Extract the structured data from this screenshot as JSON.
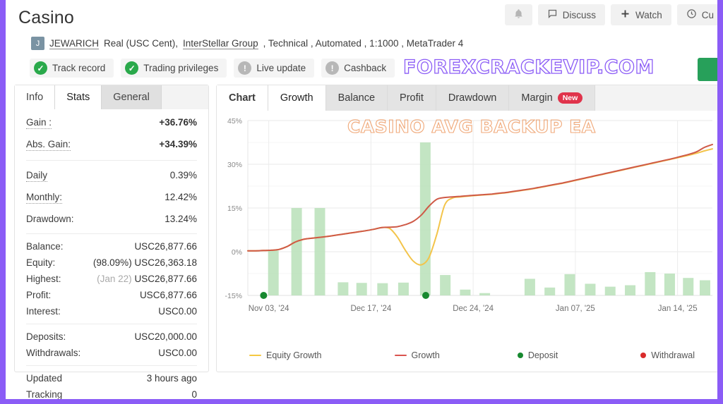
{
  "header": {
    "title": "Casino",
    "buttons": [
      {
        "name": "notifications",
        "icon": "bell-icon",
        "label": ""
      },
      {
        "name": "discuss",
        "icon": "comment-icon",
        "label": "Discuss"
      },
      {
        "name": "watch",
        "icon": "plus-icon",
        "label": "Watch"
      },
      {
        "name": "custom",
        "icon": "clock-icon",
        "label": "Cu"
      }
    ],
    "account": {
      "avatar_initial": "J",
      "name": "JEWARICH",
      "type": "Real (USC Cent),",
      "broker": "InterStellar Group",
      "meta": ", Technical , Automated , 1:1000 , MetaTrader 4"
    },
    "badges": [
      {
        "label": "Track record",
        "state": "ok"
      },
      {
        "label": "Trading privileges",
        "state": "ok"
      },
      {
        "label": "Live update",
        "state": "no"
      },
      {
        "label": "Cashback",
        "state": "no"
      }
    ],
    "watermark": "FOREXCRACKEVIP.COM"
  },
  "left_panel": {
    "tabs": [
      {
        "label": "Info",
        "active": false
      },
      {
        "label": "Stats",
        "active": true
      },
      {
        "label": "General",
        "active": false
      }
    ],
    "groups": [
      {
        "rows": [
          {
            "key": "Gain :",
            "value": "+36.76%",
            "style": "green",
            "dotted": true
          },
          {
            "key": "Abs. Gain:",
            "value": "+34.39%",
            "style": "green",
            "dotted": true
          }
        ]
      },
      {
        "rows": [
          {
            "key": "Daily",
            "value": "0.39%",
            "style": "",
            "dotted": true
          },
          {
            "key": "Monthly:",
            "value": "12.42%",
            "style": "",
            "dotted": true
          },
          {
            "key": "Drawdown:",
            "value": "13.24%",
            "style": "",
            "dotted": false
          }
        ]
      },
      {
        "rows": [
          {
            "key": "Balance:",
            "value": "USC26,877.66",
            "style": "",
            "dotted": false
          },
          {
            "key": "Equity:",
            "value": "(98.09%) USC26,363.18",
            "style": "",
            "dotted": false
          },
          {
            "key": "Highest:",
            "value": "(Jan 22) USC26,877.66",
            "style": "",
            "dotted": false,
            "prefix_muted": "(Jan 22)"
          },
          {
            "key": "Profit:",
            "value": "USC6,877.66",
            "style": "greenplain",
            "dotted": false
          },
          {
            "key": "Interest:",
            "value": "USC0.00",
            "style": "",
            "dotted": false
          }
        ]
      },
      {
        "rows": [
          {
            "key": "Deposits:",
            "value": "USC20,000.00",
            "style": "",
            "dotted": false
          },
          {
            "key": "Withdrawals:",
            "value": "USC0.00",
            "style": "",
            "dotted": false
          }
        ]
      },
      {
        "rows": [
          {
            "key": "Updated",
            "value": "3 hours ago",
            "style": "",
            "dotted": false
          },
          {
            "key": "Tracking",
            "value": "0",
            "style": "",
            "dotted": false
          }
        ]
      }
    ]
  },
  "chart_panel": {
    "tabs": [
      {
        "label": "Chart",
        "active": true,
        "badge": ""
      },
      {
        "label": "Growth",
        "active": true,
        "badge": ""
      },
      {
        "label": "Balance",
        "active": false,
        "badge": ""
      },
      {
        "label": "Profit",
        "active": false,
        "badge": ""
      },
      {
        "label": "Drawdown",
        "active": false,
        "badge": ""
      },
      {
        "label": "Margin",
        "active": false,
        "badge": "New"
      }
    ]
  },
  "chart_data": {
    "type": "line",
    "title": "CASINO AVG BACKUP EA",
    "xlabel": "",
    "ylabel": "",
    "ylim": [
      -15,
      45
    ],
    "yticks": [
      45,
      30,
      15,
      0,
      -15
    ],
    "ytick_labels": [
      "45%",
      "30%",
      "15%",
      "0%",
      "-15%"
    ],
    "xtick_labels": [
      "Nov 03, '24",
      "Dec 17, '24",
      "Dec 24, '24",
      "Jan 07, '25",
      "Jan 14, '25"
    ],
    "xtick_positions": [
      0.045,
      0.265,
      0.485,
      0.705,
      0.925
    ],
    "grid": true,
    "legend_position": "bottom",
    "legend": [
      {
        "name": "Equity Growth",
        "color": "#f5c842",
        "marker": "line"
      },
      {
        "name": "Growth",
        "color": "#d9534f",
        "marker": "line"
      },
      {
        "name": "Deposit",
        "color": "#17892f",
        "marker": "dot"
      },
      {
        "name": "Withdrawal",
        "color": "#d92b2b",
        "marker": "dot"
      }
    ],
    "series": [
      {
        "name": "Growth",
        "color": "#cf5a47",
        "values": [
          0.3,
          0.3,
          0.4,
          0.5,
          0.8,
          1.8,
          3.3,
          4.2,
          4.6,
          4.9,
          5.2,
          5.6,
          6.0,
          6.4,
          6.8,
          7.2,
          7.7,
          8.3,
          8.4,
          8.6,
          9.3,
          10.4,
          12.5,
          15.6,
          18.0,
          18.6,
          18.8,
          19.0,
          19.2,
          19.4,
          19.6,
          19.8,
          20.1,
          20.4,
          20.8,
          21.2,
          21.6,
          22.1,
          22.6,
          23.1,
          23.6,
          24.2,
          24.8,
          25.4,
          26.0,
          26.6,
          27.2,
          27.8,
          28.4,
          29.0,
          29.6,
          30.2,
          30.8,
          31.4,
          32.0,
          32.7,
          33.4,
          34.3,
          35.8,
          36.8
        ]
      },
      {
        "name": "Equity Growth",
        "color": "#f3c44a",
        "values": [
          0.3,
          0.3,
          0.4,
          0.5,
          0.8,
          1.8,
          3.3,
          4.2,
          4.6,
          4.9,
          5.2,
          5.6,
          6.0,
          6.4,
          6.8,
          7.2,
          7.7,
          8.3,
          8.0,
          5.0,
          0.5,
          -3.2,
          -4.5,
          -2.0,
          6.0,
          16.0,
          18.4,
          18.8,
          19.1,
          19.3,
          19.5,
          19.7,
          20.0,
          20.3,
          20.7,
          21.1,
          21.5,
          22.0,
          22.5,
          23.0,
          23.5,
          24.1,
          24.7,
          25.3,
          25.9,
          26.5,
          27.1,
          27.7,
          28.3,
          28.9,
          29.5,
          30.1,
          30.7,
          31.3,
          31.9,
          32.5,
          33.1,
          33.8,
          34.6,
          35.3
        ]
      }
    ],
    "bars": {
      "name": "Volume",
      "color": "#b8e0b8",
      "baseline": -15,
      "items": [
        {
          "x": 0.055,
          "value": 0.4
        },
        {
          "x": 0.105,
          "value": 15.0
        },
        {
          "x": 0.155,
          "value": 15.0
        },
        {
          "x": 0.205,
          "value": -10.5
        },
        {
          "x": 0.245,
          "value": -10.7
        },
        {
          "x": 0.29,
          "value": -10.8
        },
        {
          "x": 0.335,
          "value": -10.6
        },
        {
          "x": 0.382,
          "value": 37.5
        },
        {
          "x": 0.425,
          "value": -8.0
        },
        {
          "x": 0.468,
          "value": -13.0
        },
        {
          "x": 0.51,
          "value": -14.2
        },
        {
          "x": 0.607,
          "value": -9.3
        },
        {
          "x": 0.65,
          "value": -12.3
        },
        {
          "x": 0.693,
          "value": -7.7
        },
        {
          "x": 0.737,
          "value": -11.0
        },
        {
          "x": 0.78,
          "value": -12.0
        },
        {
          "x": 0.823,
          "value": -11.5
        },
        {
          "x": 0.866,
          "value": -7.0
        },
        {
          "x": 0.908,
          "value": -7.5
        },
        {
          "x": 0.948,
          "value": -9.0
        },
        {
          "x": 0.984,
          "value": -9.8
        }
      ]
    },
    "markers": [
      {
        "type": "Deposit",
        "x": 0.034,
        "y": -15,
        "color": "#17892f"
      },
      {
        "type": "Deposit",
        "x": 0.383,
        "y": -15,
        "color": "#17892f"
      }
    ]
  }
}
